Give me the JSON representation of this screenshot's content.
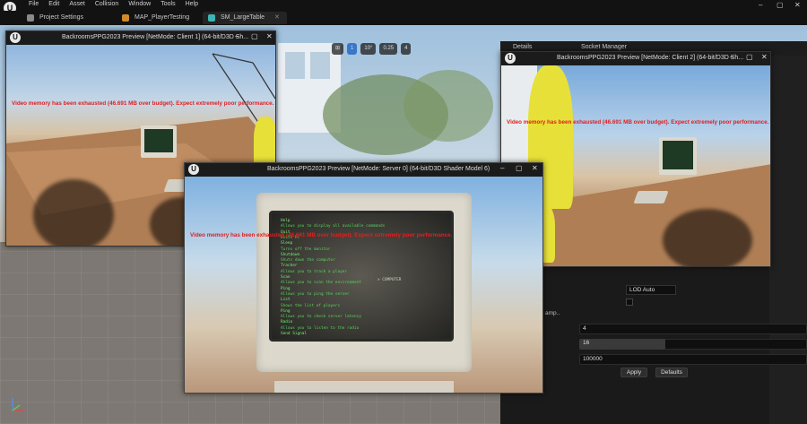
{
  "menubar": {
    "logo": "U",
    "items": [
      "File",
      "Edit",
      "Asset",
      "Collision",
      "Window",
      "Tools",
      "Help"
    ],
    "controls": [
      "–",
      "▢",
      "✕"
    ]
  },
  "tabs": [
    {
      "label": "Project Settings",
      "color": "#8a8a8a"
    },
    {
      "label": "MAP_PlayerTesting",
      "color": "#d08a2c"
    },
    {
      "label": "SM_LargeTable",
      "color": "#3cb5b5"
    }
  ],
  "viewport_toolbar": [
    "1",
    "10°",
    "0.25",
    "4"
  ],
  "details": {
    "tab_details": "Details",
    "tab_socket": "Socket Manager",
    "lod_value": "LOD Auto",
    "section_label": "amp..",
    "rows": [
      {
        "value": "4"
      },
      {
        "value": "16",
        "fill": 0.35
      },
      {
        "value": "100000"
      }
    ],
    "apply_label": "Apply",
    "defaults_label": "Defaults"
  },
  "pie_client1": {
    "title": "BackroomsPPG2023 Preview [NetMode: Client 1]  (64-bit/D3D Sh...",
    "warning": "Video memory has been exhausted (46.691 MB over budget). Expect extremely poor performance."
  },
  "pie_client2": {
    "title": "BackroomsPPG2023 Preview [NetMode: Client 2]  (64-bit/D3D Sh...",
    "warning": "Video memory has been exhausted (46.691 MB over budget). Expect extremely poor performance."
  },
  "pie_server": {
    "title": "BackroomsPPG2023 Preview [NetMode: Server 0]  (64-bit/D3D Shader Model 6)",
    "warning": "Video memory has been exhausted (46.691 MB over budget). Expect extremely poor performance.",
    "terminal_lines": [
      "Help",
      "  Allows you to display all available commands",
      "Quit",
      "  Exits PC",
      "Sleep",
      "  Turns off the monitor",
      "Shutdown",
      "  Shuts down the computer",
      "Tracker",
      "  Allows you to track a player",
      "Scan",
      "  Allows you to scan the environment",
      "Ping",
      "  Allows you to ping the server",
      "List",
      "  Shows the list of players",
      "Ping",
      "  Allows you to check server latency",
      "Radio",
      "  Allows you to listen to the radio",
      "Send Signal"
    ],
    "cursor_text": "> COMPUTER"
  },
  "colors": {
    "warning": "#e02020",
    "terminal_green": "#7cf07c",
    "accent_blue": "#3877c9"
  }
}
